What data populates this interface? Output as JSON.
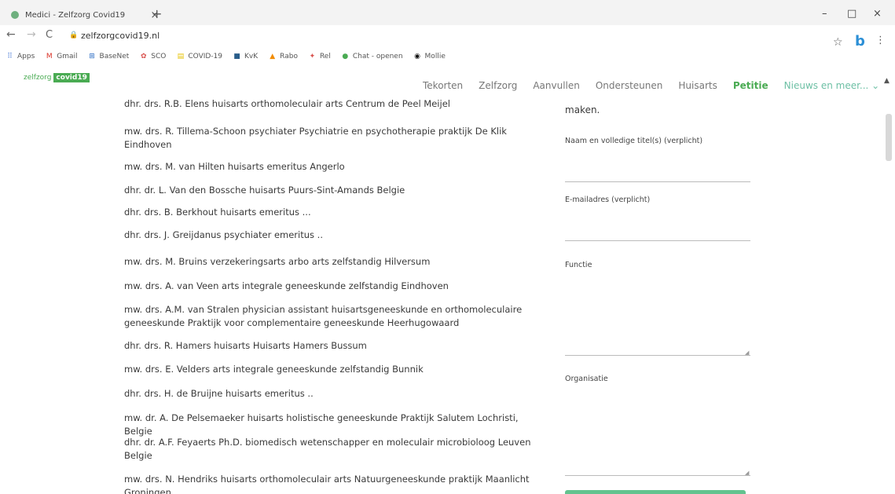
{
  "browser": {
    "tab_title": "Medici - Zelfzorg Covid19",
    "tab_close": "×",
    "new_tab": "+",
    "minimize": "–",
    "maximize": "□",
    "close": "×",
    "back": "←",
    "forward": "→",
    "reload": "C",
    "url": "zelfzorgcovid19.nl",
    "extension_letter": "b",
    "bookmarks": [
      {
        "label": "Apps",
        "icon": "apps-grid-icon",
        "glyph": "⠿",
        "color": "#4a7bd6"
      },
      {
        "label": "Gmail",
        "icon": "gmail-icon",
        "glyph": "M",
        "color": "#d93025"
      },
      {
        "label": "BaseNet",
        "icon": "basenet-icon",
        "glyph": "⊞",
        "color": "#2b6cc4"
      },
      {
        "label": "SCO",
        "icon": "sco-icon",
        "glyph": "✿",
        "color": "#d9534f"
      },
      {
        "label": "COVID-19",
        "icon": "covid-icon",
        "glyph": "▤",
        "color": "#e6c200"
      },
      {
        "label": "KvK",
        "icon": "kvk-icon",
        "glyph": "■",
        "color": "#2a5d8a"
      },
      {
        "label": "Rabo",
        "icon": "rabo-icon",
        "glyph": "▲",
        "color": "#f28c00"
      },
      {
        "label": "Rel",
        "icon": "rel-icon",
        "glyph": "✦",
        "color": "#d9534f"
      },
      {
        "label": "Chat - openen",
        "icon": "chat-icon",
        "glyph": "●",
        "color": "#4aab53"
      },
      {
        "label": "Mollie",
        "icon": "mollie-icon",
        "glyph": "◉",
        "color": "#111111"
      }
    ]
  },
  "site": {
    "logo_text": "zelfzorg",
    "logo_badge": "covid19",
    "nav": [
      "Tekorten",
      "Zelfzorg",
      "Aanvullen",
      "Ondersteunen",
      "Huisarts",
      "Petitie",
      "Nieuws en meer... ⌄"
    ],
    "active_nav": "Petitie"
  },
  "signatories": [
    {
      "lines": [
        "dhr. drs. R.B. Elens huisarts orthomoleculair arts Centrum de Peel Meijel"
      ]
    },
    {
      "lines": [
        "mw. drs. R. Tillema-Schoon psychiater Psychiatrie en psychotherapie praktijk De Klik",
        "Eindhoven"
      ]
    },
    {
      "lines": [
        "mw. drs. M. van Hilten huisarts emeritus Angerlo"
      ]
    },
    {
      "lines": [
        "dhr. dr. L. Van den Bossche huisarts Puurs-Sint-Amands Belgie"
      ]
    },
    {
      "lines": [
        "dhr. drs. B. Berkhout huisarts emeritus ..."
      ]
    },
    {
      "lines": [
        "dhr. drs. J. Greijdanus psychiater emeritus .."
      ]
    },
    {
      "lines": [
        "mw. drs. M. Bruins verzekeringsarts arbo arts zelfstandig Hilversum"
      ]
    },
    {
      "lines": [
        "mw. drs. A. van Veen arts integrale geneeskunde zelfstandig Eindhoven"
      ]
    },
    {
      "lines": [
        "mw. drs. A.M. van Stralen physician assistant huisartsgeneeskunde en orthomoleculaire",
        "geneeskunde Praktijk voor complementaire geneeskunde Heerhugowaard"
      ]
    },
    {
      "lines": [
        "dhr. drs. R. Hamers huisarts Huisarts Hamers Bussum"
      ]
    },
    {
      "lines": [
        "mw. drs. E. Velders arts integrale geneeskunde zelfstandig Bunnik"
      ]
    },
    {
      "lines": [
        "dhr. drs. H. de Bruijne huisarts emeritus .."
      ]
    },
    {
      "lines": [
        "mw. dr. A. De Pelsemaeker huisarts holistische geneeskunde Praktijk Salutem Lochristi, Belgie"
      ]
    },
    {
      "lines": [
        "dhr. dr. A.F. Feyaerts Ph.D. biomedisch wetenschapper en moleculair microbioloog Leuven",
        "Belgie"
      ]
    },
    {
      "lines": [
        "mw. drs. N. Hendriks huisarts orthomoleculair arts Natuurgeneeskunde praktijk Maanlicht",
        "Groningen"
      ]
    }
  ],
  "form": {
    "intro_tail": "maken.",
    "name_label": "Naam en volledige titel(s) (verplicht)",
    "email_label": "E-mailadres (verplicht)",
    "function_label": "Functie",
    "organisation_label": "Organisatie"
  }
}
